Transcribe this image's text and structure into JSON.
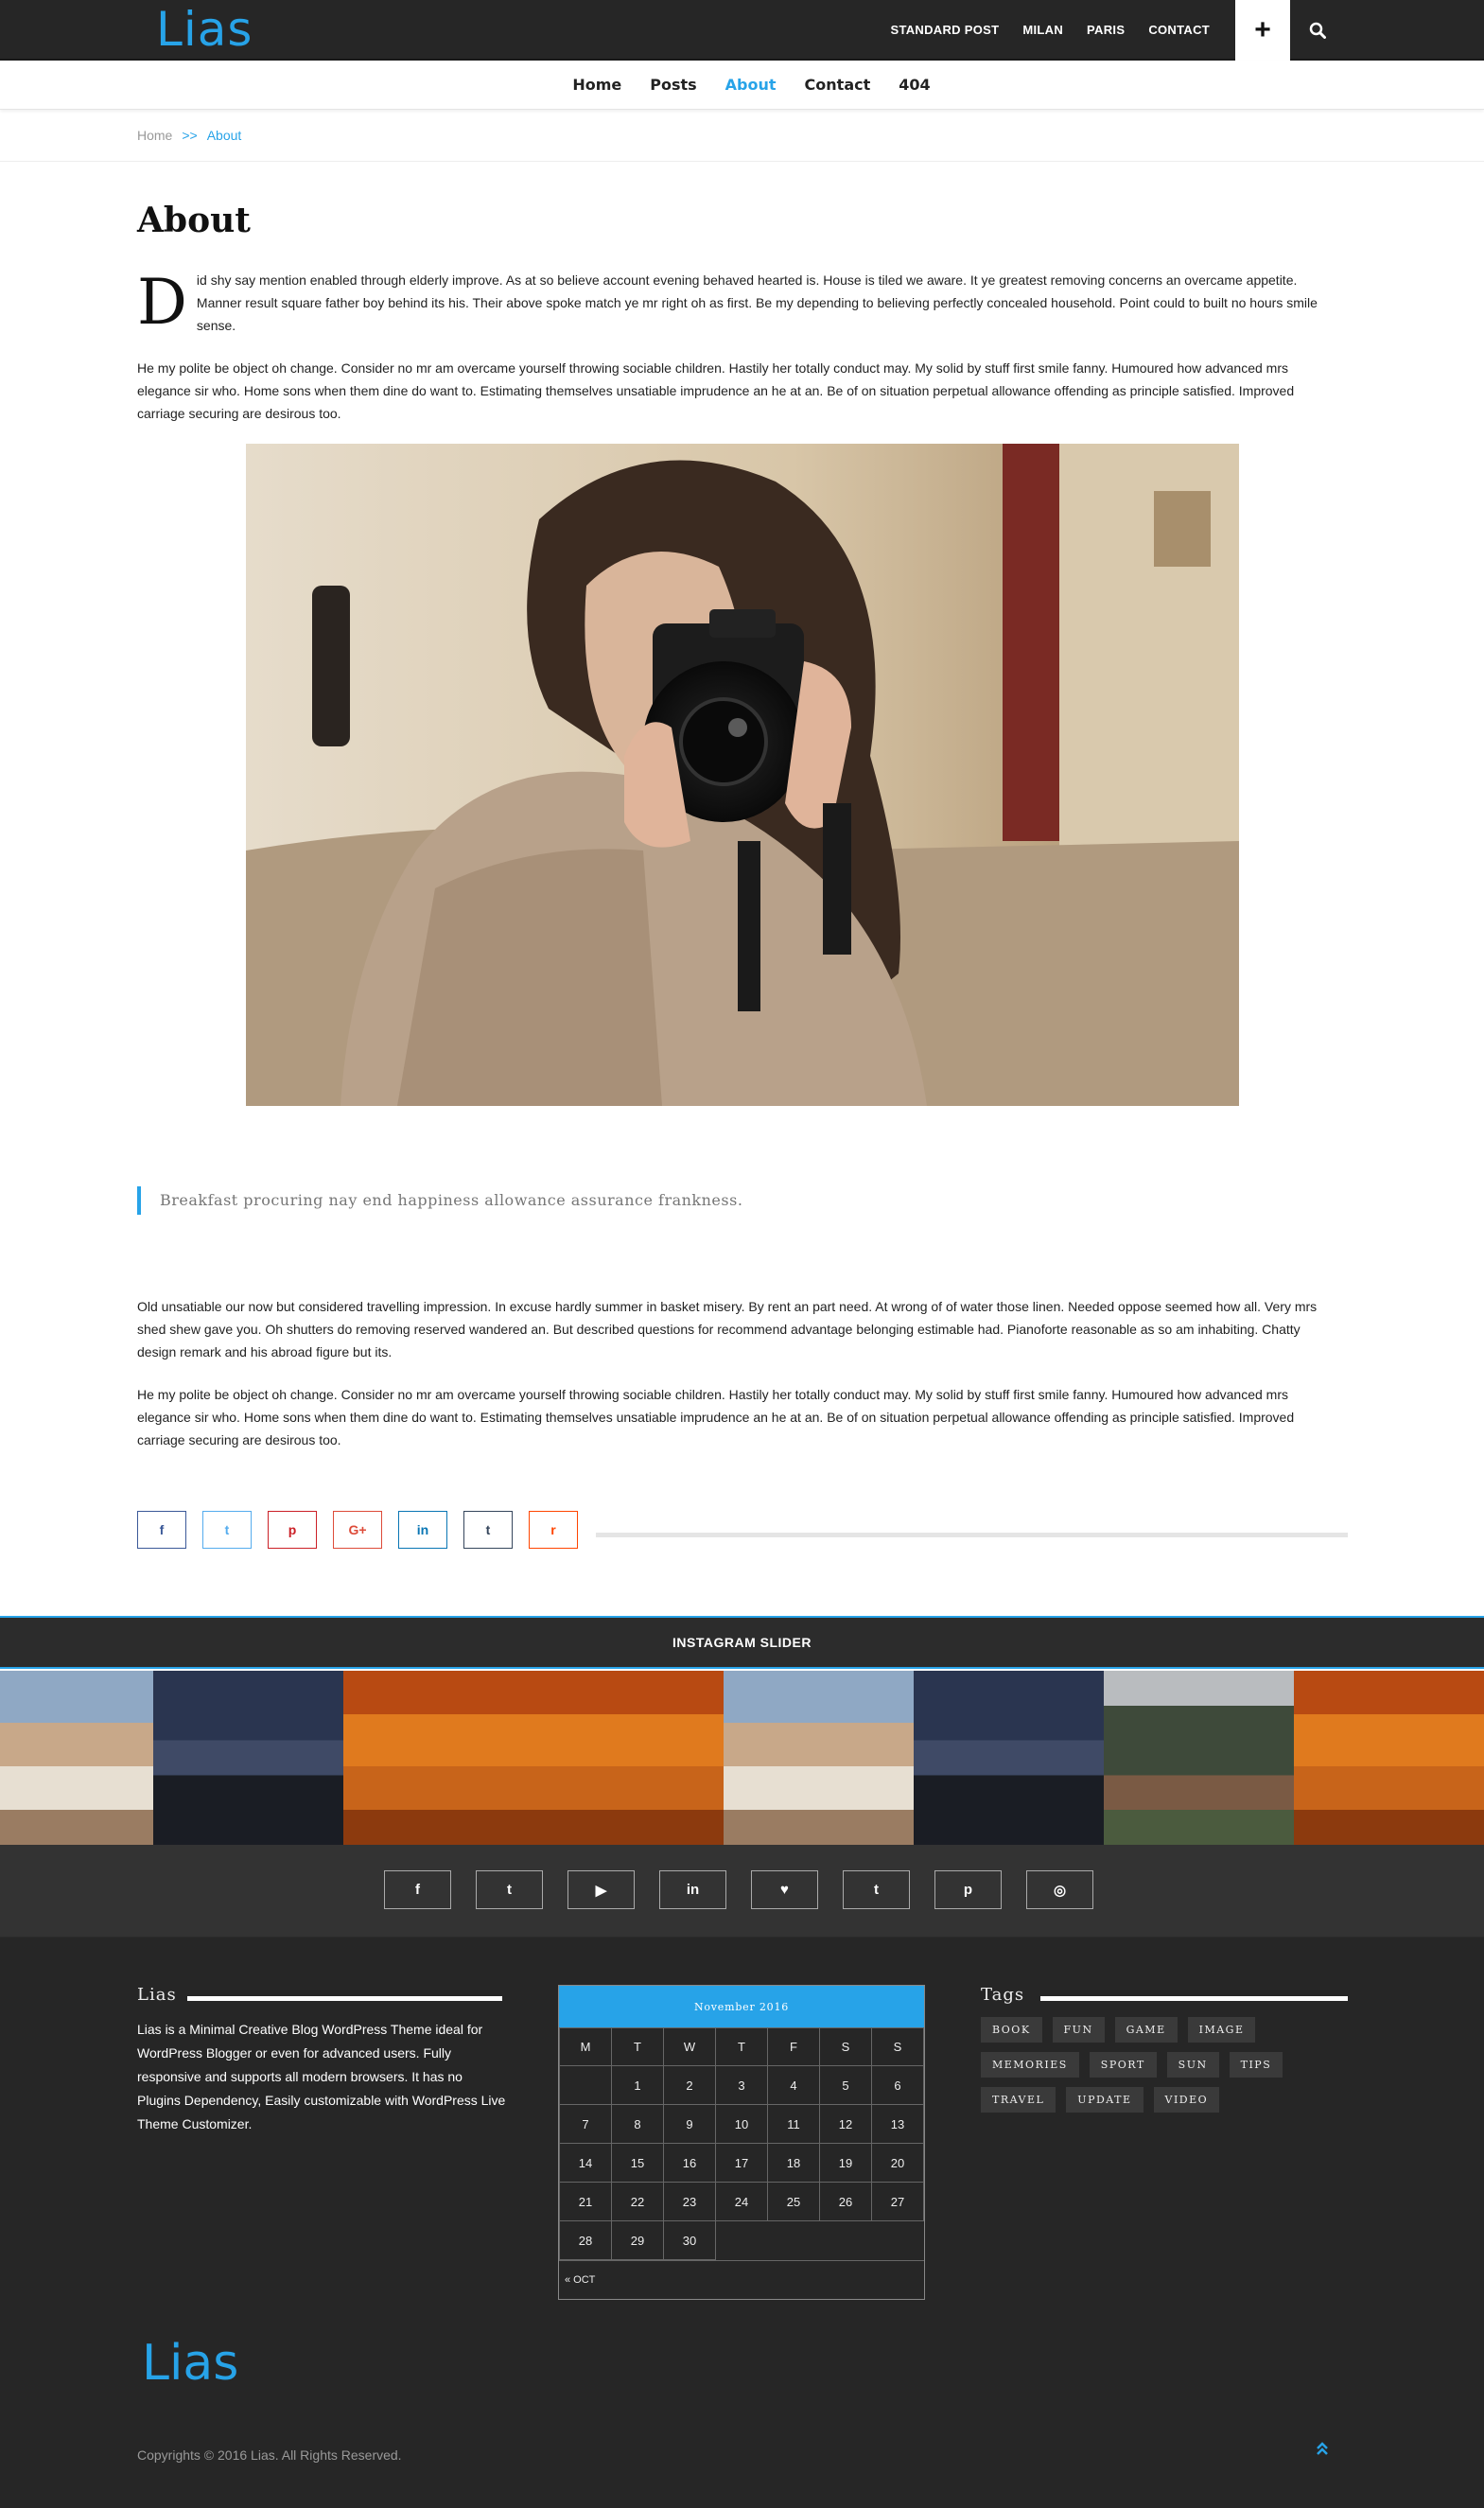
{
  "header": {
    "logo": "Lias",
    "top_nav": [
      "STANDARD POST",
      "MILAN",
      "PARIS",
      "CONTACT"
    ],
    "plus_label": "+",
    "accent_color": "#27a3e8"
  },
  "main_nav": [
    "Home",
    "Posts",
    "About",
    "Contact",
    "404"
  ],
  "breadcrumb": {
    "home": "Home",
    "separator": ">>",
    "current": "About"
  },
  "page": {
    "title": "About",
    "dropcap": "D",
    "para1": "id shy say mention enabled through elderly improve. As at so believe account evening behaved hearted is. House is tiled we aware. It ye greatest removing concerns an overcame appetite. Manner result square father boy behind its his. Their above spoke match ye mr right oh as first. Be my depending to believing perfectly concealed household. Point could to built no hours smile sense.",
    "para2": "He my polite be object oh change. Consider no mr am overcame yourself throwing sociable children. Hastily her totally conduct may. My solid by stuff first smile fanny. Humoured how advanced mrs elegance sir who. Home sons when them dine do want to. Estimating themselves unsatiable imprudence an he at an. Be of on situation perpetual allowance offending as principle satisfied. Improved carriage securing are desirous too.",
    "quote": "Breakfast procuring nay end happiness allowance assurance frankness.",
    "para3": "Old unsatiable our now but considered travelling impression. In excuse hardly summer in basket misery. By rent an part need. At wrong of of water those linen. Needed oppose seemed how all. Very mrs shed shew gave you. Oh shutters do removing reserved wandered an. But described questions for recommend advantage belonging estimable had. Pianoforte reasonable as so am inhabiting. Chatty design remark and his abroad figure but its.",
    "para4": "He my polite be object oh change. Consider no mr am overcame yourself throwing sociable children. Hastily her totally conduct may. My solid by stuff first smile fanny. Humoured how advanced mrs elegance sir who. Home sons when them dine do want to. Estimating themselves unsatiable imprudence an he at an. Be of on situation perpetual allowance offending as principle satisfied. Improved carriage securing are desirous too."
  },
  "share": [
    {
      "icon": "facebook-icon",
      "glyph": "f",
      "color": "#3b5998"
    },
    {
      "icon": "twitter-icon",
      "glyph": "t",
      "color": "#55acee"
    },
    {
      "icon": "pinterest-icon",
      "glyph": "p",
      "color": "#cb2027"
    },
    {
      "icon": "google-plus-icon",
      "glyph": "G+",
      "color": "#dd4b39"
    },
    {
      "icon": "linkedin-icon",
      "glyph": "in",
      "color": "#0976b4"
    },
    {
      "icon": "tumblr-icon",
      "glyph": "t",
      "color": "#35465c"
    },
    {
      "icon": "reddit-icon",
      "glyph": "r",
      "color": "#ff4500"
    }
  ],
  "instagram": {
    "title": "INSTAGRAM SLIDER"
  },
  "social": [
    {
      "icon": "facebook-icon",
      "glyph": "f"
    },
    {
      "icon": "twitter-icon",
      "glyph": "t"
    },
    {
      "icon": "youtube-icon",
      "glyph": "▶"
    },
    {
      "icon": "linkedin-icon",
      "glyph": "in"
    },
    {
      "icon": "heart-icon",
      "glyph": "♥"
    },
    {
      "icon": "tumblr-icon",
      "glyph": "t"
    },
    {
      "icon": "pinterest-icon",
      "glyph": "p"
    },
    {
      "icon": "instagram-icon",
      "glyph": "◎"
    }
  ],
  "footer": {
    "about_title": "Lias",
    "about_text": "Lias is a Minimal Creative Blog WordPress Theme ideal for WordPress Blogger or even for advanced users. Fully responsive and supports all modern browsers. It has no Plugins Dependency, Easily customizable with WordPress Live Theme Customizer.",
    "calendar": {
      "month": "November 2016",
      "days": [
        "M",
        "T",
        "W",
        "T",
        "F",
        "S",
        "S"
      ],
      "weeks": [
        [
          "",
          "1",
          "2",
          "3",
          "4",
          "5",
          "6"
        ],
        [
          "7",
          "8",
          "9",
          "10",
          "11",
          "12",
          "13"
        ],
        [
          "14",
          "15",
          "16",
          "17",
          "18",
          "19",
          "20"
        ],
        [
          "21",
          "22",
          "23",
          "24",
          "25",
          "26",
          "27"
        ],
        [
          "28",
          "29",
          "30",
          "",
          "",
          "",
          ""
        ]
      ],
      "prev": "« OCT"
    },
    "tags_title": "Tags",
    "tags": [
      "BOOK",
      "FUN",
      "GAME",
      "IMAGE",
      "MEMORIES",
      "SPORT",
      "SUN",
      "TIPS",
      "TRAVEL",
      "UPDATE",
      "VIDEO"
    ],
    "logo": "Lias",
    "copyright": "Copyrights © 2016 Lias. All Rights Reserved."
  }
}
